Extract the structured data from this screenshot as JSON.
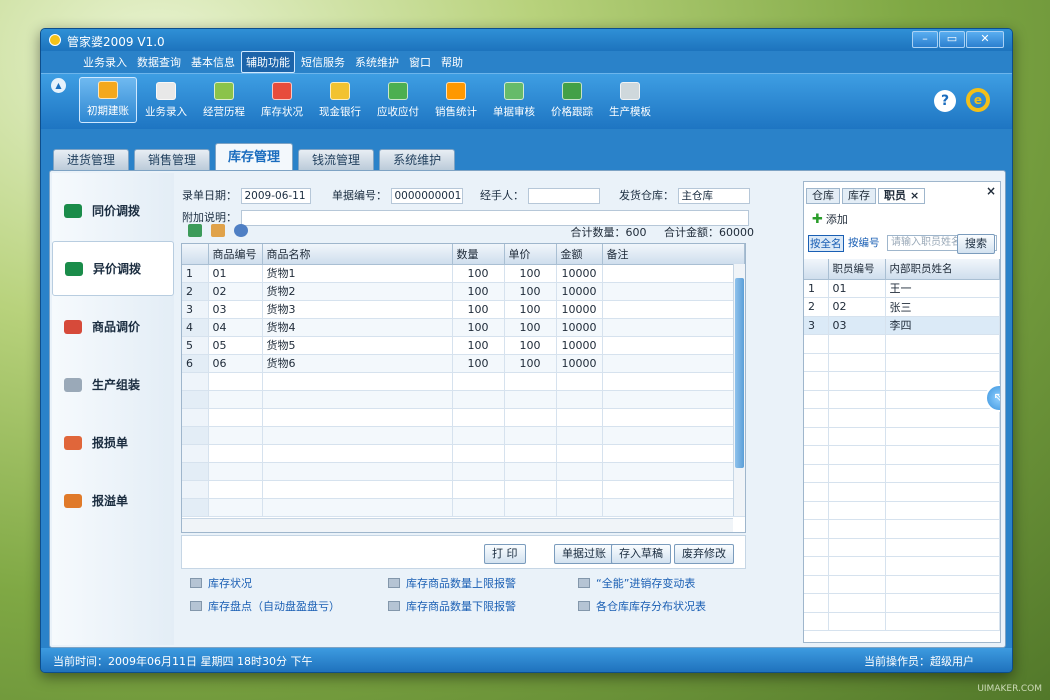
{
  "window": {
    "title": "管家婆2009 V1.0"
  },
  "menu": [
    "业务录入",
    "数据查询",
    "基本信息",
    "辅助功能",
    "短信服务",
    "系统维护",
    "窗口",
    "帮助"
  ],
  "menu_active": "辅助功能",
  "toolbar": [
    {
      "label": "初期建账",
      "icon": "ledger-icon",
      "color": "#f4a81d"
    },
    {
      "label": "业务录入",
      "icon": "edit-icon",
      "color": "#e8e8e8"
    },
    {
      "label": "经营历程",
      "icon": "history-icon",
      "color": "#8bc34a"
    },
    {
      "label": "库存状况",
      "icon": "house-icon",
      "color": "#e74c3c"
    },
    {
      "label": "现金银行",
      "icon": "yen-icon",
      "color": "#f2c230"
    },
    {
      "label": "应收应付",
      "icon": "receivable-icon",
      "color": "#4caf50"
    },
    {
      "label": "销售统计",
      "icon": "bar-chart-icon",
      "color": "#ff9800"
    },
    {
      "label": "单据审核",
      "icon": "audit-icon",
      "color": "#66bb6a"
    },
    {
      "label": "价格跟踪",
      "icon": "price-icon",
      "color": "#43a047"
    },
    {
      "label": "生产模板",
      "icon": "gears-icon",
      "color": "#cfd8dc"
    }
  ],
  "tabs": [
    "进货管理",
    "销售管理",
    "库存管理",
    "钱流管理",
    "系统维护"
  ],
  "tab_active": "库存管理",
  "sidebar": [
    {
      "label": "同价调拨",
      "icon": "swap-icon",
      "color": "#1a8c4a"
    },
    {
      "label": "异价调拨",
      "icon": "swap-icon",
      "color": "#1a8c4a"
    },
    {
      "label": "商品调价",
      "icon": "price-adjust-icon",
      "color": "#d64a3a"
    },
    {
      "label": "生产组装",
      "icon": "wrench-icon",
      "color": "#9aa9b8"
    },
    {
      "label": "报损单",
      "icon": "loss-icon",
      "color": "#e0663a"
    },
    {
      "label": "报溢单",
      "icon": "overflow-icon",
      "color": "#e07a2a"
    }
  ],
  "sidebar_active": "异价调拨",
  "form": {
    "date_label": "录单日期：",
    "date": "2009-06-11",
    "no_label": "单据编号：",
    "no": "0000000001",
    "handler_label": "经手人：",
    "handler": "",
    "warehouse_label": "发货仓库：",
    "warehouse": "主仓库",
    "note_label": "附加说明：",
    "note": ""
  },
  "totals": {
    "qty": "合计数量：600",
    "amount": "合计金额：60000"
  },
  "grid": {
    "headers": [
      "",
      "商品编号",
      "商品名称",
      "数量",
      "单价",
      "金额",
      "备注"
    ],
    "rows": [
      [
        "1",
        "01",
        "货物1",
        "100",
        "100",
        "10000",
        ""
      ],
      [
        "2",
        "02",
        "货物2",
        "100",
        "100",
        "10000",
        ""
      ],
      [
        "3",
        "03",
        "货物3",
        "100",
        "100",
        "10000",
        ""
      ],
      [
        "4",
        "04",
        "货物4",
        "100",
        "100",
        "10000",
        ""
      ],
      [
        "5",
        "05",
        "货物5",
        "100",
        "100",
        "10000",
        ""
      ],
      [
        "6",
        "06",
        "货物6",
        "100",
        "100",
        "10000",
        ""
      ]
    ]
  },
  "actions": [
    "打 印",
    "单据过账",
    "存入草稿",
    "废弃修改"
  ],
  "links": [
    [
      "库存状况",
      "库存商品数量上限报警",
      "“全能”进销存变动表"
    ],
    [
      "库存盘点（自动盘盈盘亏）",
      "库存商品数量下限报警",
      "各仓库库存分布状况表"
    ]
  ],
  "right": {
    "tabs": [
      "仓库",
      "库存",
      "职员"
    ],
    "tab_active": "职员",
    "close": "×",
    "tab_close": "×",
    "add": "添加",
    "by_name": "按全名",
    "by_code": "按编号",
    "placeholder": "请输入职员姓名",
    "search": "搜索",
    "headers": [
      "",
      "职员编号",
      "内部职员姓名"
    ],
    "rows": [
      [
        "1",
        "01",
        "王一"
      ],
      [
        "2",
        "02",
        "张三"
      ],
      [
        "3",
        "03",
        "李四"
      ]
    ],
    "selected_row": 3
  },
  "status": {
    "left": "当前时间：2009年06月11日 星期四 18时30分 下午",
    "right": "当前操作员：超级用户"
  },
  "watermark": "UIMAKER.COM"
}
